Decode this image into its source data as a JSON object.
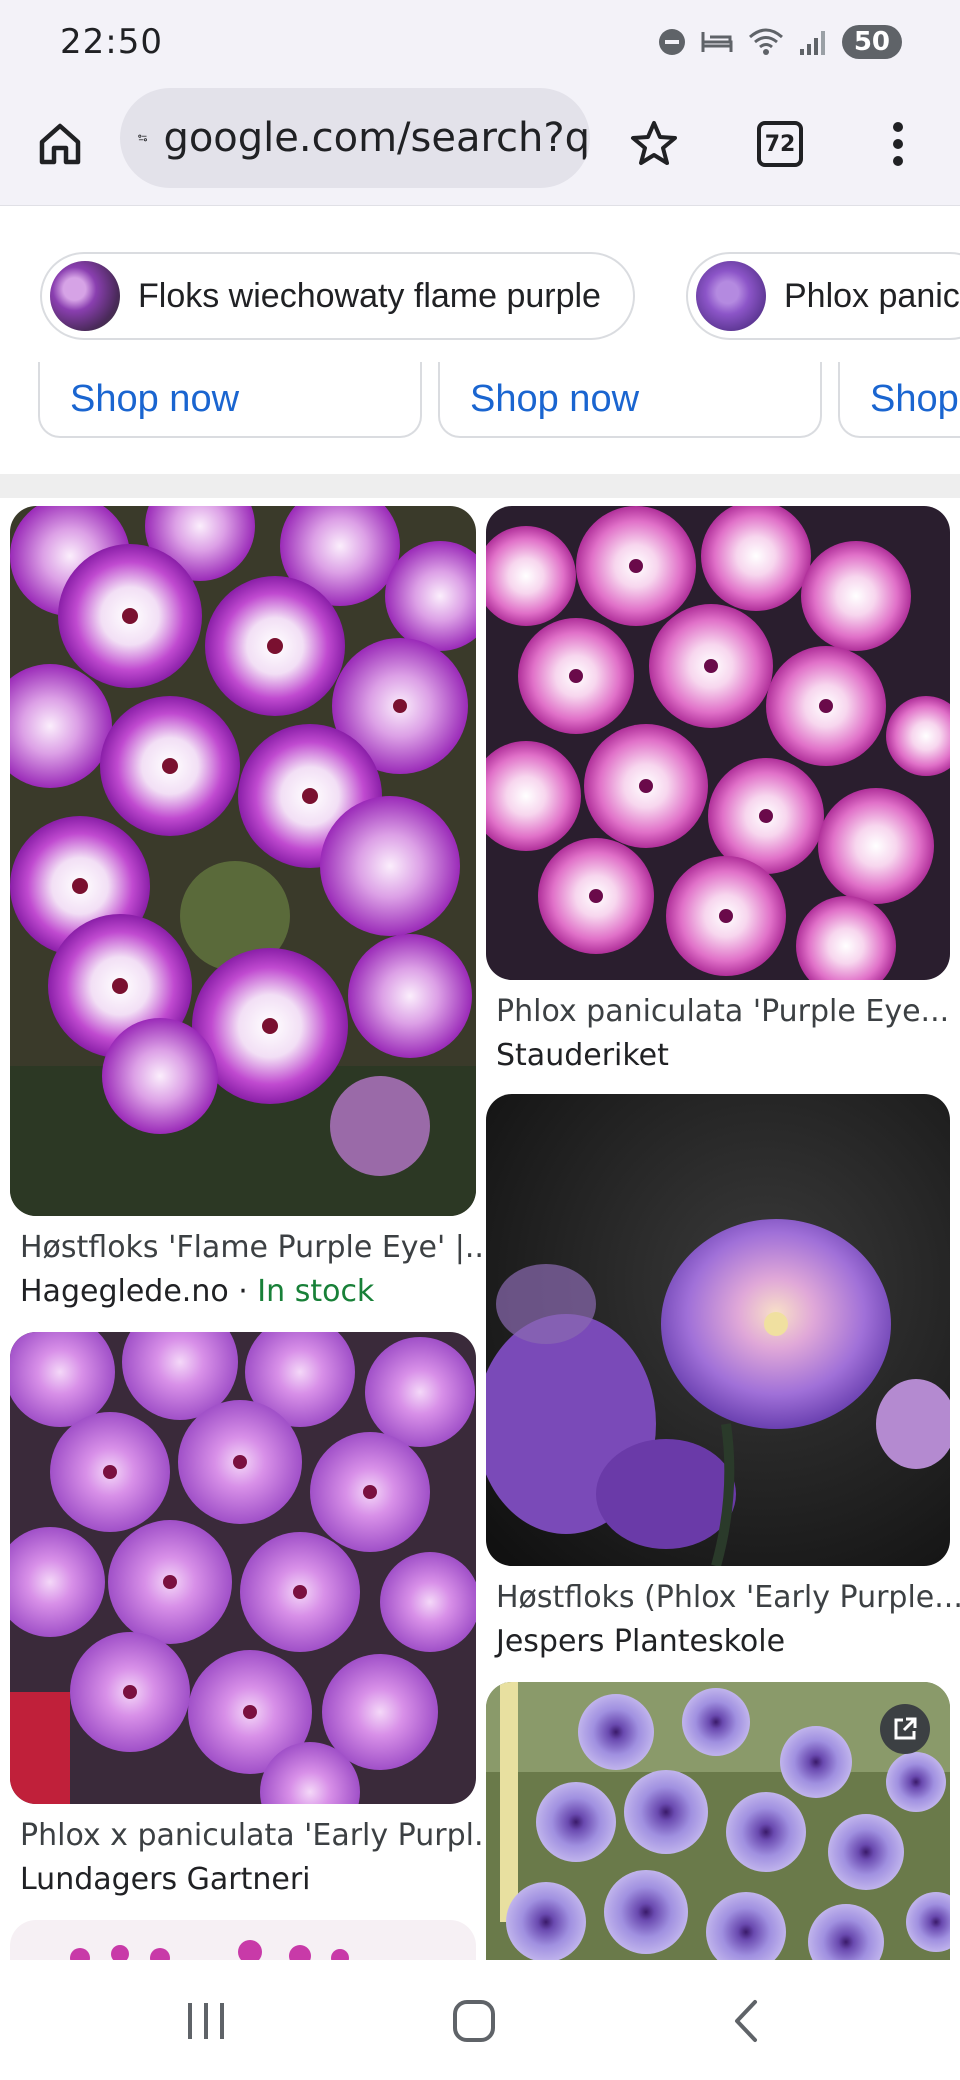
{
  "status_bar": {
    "time": "22:50",
    "battery": "50"
  },
  "toolbar": {
    "url": "google.com/search?q",
    "tab_count": "72"
  },
  "chips": [
    {
      "label": "Floks wiechowaty flame purple"
    },
    {
      "label": "Phlox panic"
    }
  ],
  "shop_buttons": [
    {
      "label": "Shop now"
    },
    {
      "label": "Shop now"
    },
    {
      "label": "Shop"
    }
  ],
  "results": [
    {
      "title": "Høstfloks 'Flame Purple Eye' |...",
      "source": "Hageglede.no",
      "separator": " · ",
      "stock": "In stock"
    },
    {
      "title": "Phlox paniculata 'Purple Eye...",
      "source": "Stauderiket"
    },
    {
      "title": "Høstfloks (Phlox 'Early Purple...",
      "source": "Jespers Planteskole"
    },
    {
      "title": "Phlox x paniculata 'Early Purpl...",
      "source": "Lundagers Gartneri"
    }
  ],
  "colors": {
    "link": "#1a65d0",
    "in_stock": "#188038",
    "chrome_bg": "#f3f2f8"
  },
  "icons": [
    "home-icon",
    "site-settings-icon",
    "bookmark-star-icon",
    "tab-switcher-icon",
    "more-vert-icon",
    "recents-icon",
    "home-nav-icon",
    "back-icon",
    "open-external-icon"
  ]
}
